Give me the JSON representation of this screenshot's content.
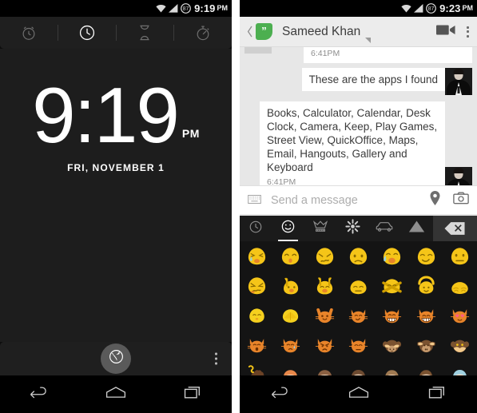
{
  "left_phone": {
    "status_bar": {
      "time": "9:19",
      "ampm": "PM",
      "battery_level": "87",
      "wifi_icon": "wifi-icon",
      "signal_icon": "signal-icon",
      "battery_icon": "battery-icon"
    },
    "clock_app": {
      "tabs": [
        {
          "name": "alarm",
          "icon": "alarm-clock-icon",
          "active": false
        },
        {
          "name": "clock",
          "icon": "clock-icon",
          "active": true
        },
        {
          "name": "timer",
          "icon": "hourglass-icon",
          "active": false
        },
        {
          "name": "stopwatch",
          "icon": "stopwatch-icon",
          "active": false
        }
      ],
      "time_display": "9:19",
      "ampm": "PM",
      "date": "FRI, NOVEMBER 1",
      "world_clock_icon": "globe-icon",
      "overflow_icon": "overflow-menu-icon"
    },
    "nav_bar": {
      "back_icon": "back-arrow-icon",
      "home_icon": "home-icon",
      "recents_icon": "recent-apps-icon"
    }
  },
  "right_phone": {
    "status_bar": {
      "time": "9:23",
      "ampm": "PM",
      "battery_level": "87",
      "wifi_icon": "wifi-icon",
      "signal_icon": "signal-icon",
      "battery_icon": "battery-icon"
    },
    "hangouts": {
      "back_icon": "back-chevron-icon",
      "app_logo": "hangouts-logo-icon",
      "logo_glyph": "”",
      "contact_name": "Sameed Khan",
      "caret_icon": "dropdown-caret-icon",
      "video_call_icon": "video-camera-icon",
      "overflow_icon": "overflow-menu-icon",
      "messages": [
        {
          "id": "msg-cut",
          "direction": "in",
          "text": "",
          "timestamp": "6:41PM",
          "cut_off": true
        },
        {
          "id": "msg-out-1",
          "direction": "out",
          "text": "These are the apps I found",
          "timestamp": ""
        },
        {
          "id": "msg-out-2",
          "direction": "out",
          "text": "Books, Calculator, Calendar, Desk Clock, Camera, Keep, Play Games, Street View, QuickOffice, Maps, Email, Hangouts, Gallery and Keyboard",
          "timestamp": "6:41PM"
        }
      ],
      "compose": {
        "keyboard_icon": "keyboard-icon",
        "placeholder": "Send a message",
        "location_icon": "location-pin-icon",
        "camera_icon": "camera-icon"
      }
    },
    "emoji_keyboard": {
      "tabs": [
        {
          "name": "recent",
          "icon": "clock-icon",
          "active": false
        },
        {
          "name": "emotions",
          "icon": "smiley-face-icon",
          "active": true
        },
        {
          "name": "people",
          "icon": "crown-icon",
          "active": false
        },
        {
          "name": "nature",
          "icon": "flower-icon",
          "active": false
        },
        {
          "name": "places",
          "icon": "car-icon",
          "active": false
        },
        {
          "name": "symbols",
          "icon": "mountain-icon",
          "active": false
        }
      ],
      "delete_icon": "backspace-delete-icon",
      "columns": 7,
      "emoji_rows": [
        [
          "weary-blob",
          "kissing-blob",
          "confounded-blob",
          "frowning-blob",
          "crying-loud-blob",
          "smirking-blob",
          "neutral-blob"
        ],
        [
          "persevere-blob",
          "raising-hand-blob",
          "raising-both-hands-blob",
          "downcast-blob",
          "no-good-blob",
          "ok-gesture-blob",
          "bowing-blob"
        ],
        [
          "pensive-blob",
          "praying-blob",
          "smiling-cat",
          "grinning-cat",
          "grinning-cat-eyes",
          "joy-cat",
          "heart-eyes-cat"
        ],
        [
          "kissing-cat",
          "crying-cat",
          "pouting-cat",
          "weary-cat",
          "see-no-evil-monkey",
          "hear-no-evil-monkey",
          "speak-no-evil-monkey"
        ],
        [
          "poop-face",
          "orange-hair-person",
          "brown-hair-person",
          "dark-hair-person",
          "long-hair-person",
          "woman-person",
          "blue-hair-person"
        ]
      ]
    },
    "nav_bar": {
      "back_icon": "back-arrow-icon",
      "home_icon": "home-icon",
      "recents_icon": "recent-apps-icon"
    }
  }
}
